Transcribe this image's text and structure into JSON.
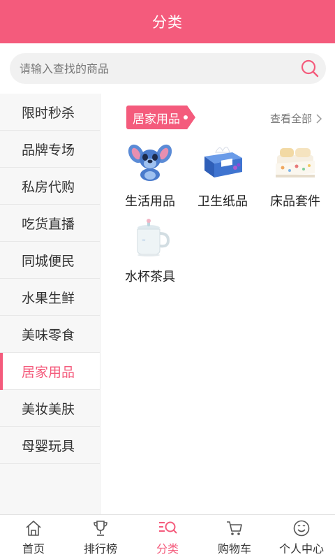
{
  "header": {
    "title": "分类"
  },
  "search": {
    "placeholder": "请输入查找的商品"
  },
  "sidebar": {
    "items": [
      {
        "label": "限时秒杀",
        "active": false
      },
      {
        "label": "品牌专场",
        "active": false
      },
      {
        "label": "私房代购",
        "active": false
      },
      {
        "label": "吃货直播",
        "active": false
      },
      {
        "label": "同城便民",
        "active": false
      },
      {
        "label": "水果生鲜",
        "active": false
      },
      {
        "label": "美味零食",
        "active": false
      },
      {
        "label": "居家用品",
        "active": true
      },
      {
        "label": "美妆美肤",
        "active": false
      },
      {
        "label": "母婴玩具",
        "active": false
      }
    ]
  },
  "section": {
    "title": "居家用品",
    "view_all": "查看全部",
    "items": [
      {
        "label": "生活用品",
        "icon": "plush-toy-icon"
      },
      {
        "label": "卫生纸品",
        "icon": "tissue-box-icon"
      },
      {
        "label": "床品套件",
        "icon": "bedding-set-icon"
      },
      {
        "label": "水杯茶具",
        "icon": "mug-icon"
      }
    ]
  },
  "tabbar": {
    "items": [
      {
        "label": "首页",
        "icon": "home-icon",
        "active": false
      },
      {
        "label": "排行榜",
        "icon": "trophy-icon",
        "active": false
      },
      {
        "label": "分类",
        "icon": "category-icon",
        "active": true
      },
      {
        "label": "购物车",
        "icon": "cart-icon",
        "active": false
      },
      {
        "label": "个人中心",
        "icon": "smiley-icon",
        "active": false
      }
    ]
  },
  "colors": {
    "accent": "#f45b7c",
    "sidebar_bg": "#f7f7f7",
    "search_bg": "#f1f1f1"
  }
}
